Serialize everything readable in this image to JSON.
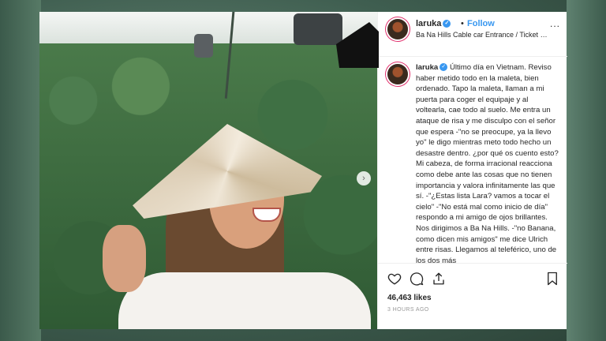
{
  "post": {
    "username": "laruka",
    "follow_label": "Follow",
    "separator": "•",
    "location": "Ba Na Hills Cable car Entrance / Ticket Counte...",
    "more_label": "...",
    "caption_user": "laruka",
    "caption_text": " Último día en Vietnam. Reviso haber metido todo en la maleta, bien ordenado. Tapo la maleta, llaman a mi puerta para coger el equipaje y al voltearla, cae todo al suelo. Me entra un ataque de risa y me disculpo con el señor que espera -\"no se preocupe, ya la llevo yo\" le digo mientras meto todo hecho un desastre dentro. ¿por qué os cuento esto? Mi cabeza, de forma irracional reacciona como debe ante las cosas que no tienen importancia y valora infinitamente las que sí. -\"¿Estas lista Lara? vamos a tocar el cielo\" -\"No está mal como inicio de día\" respondo a mi amigo de ojos brillantes. Nos dirigimos a Ba Na Hills. -\"no Banana, como dicen mis amigos\" me dice Ulrich entre risas. Llegamos al teleférico, uno de los dos más",
    "likes": "46,463 likes",
    "time_ago": "3 HOURS AGO",
    "next_icon": "›"
  },
  "icons": {
    "like": "heart-icon",
    "comment": "comment-icon",
    "share": "share-icon",
    "save": "bookmark-icon",
    "verified": "verified-badge-icon"
  },
  "colors": {
    "link_blue": "#3897f0",
    "text": "#262626",
    "muted": "#999999",
    "story_ring": "#e1306c"
  }
}
